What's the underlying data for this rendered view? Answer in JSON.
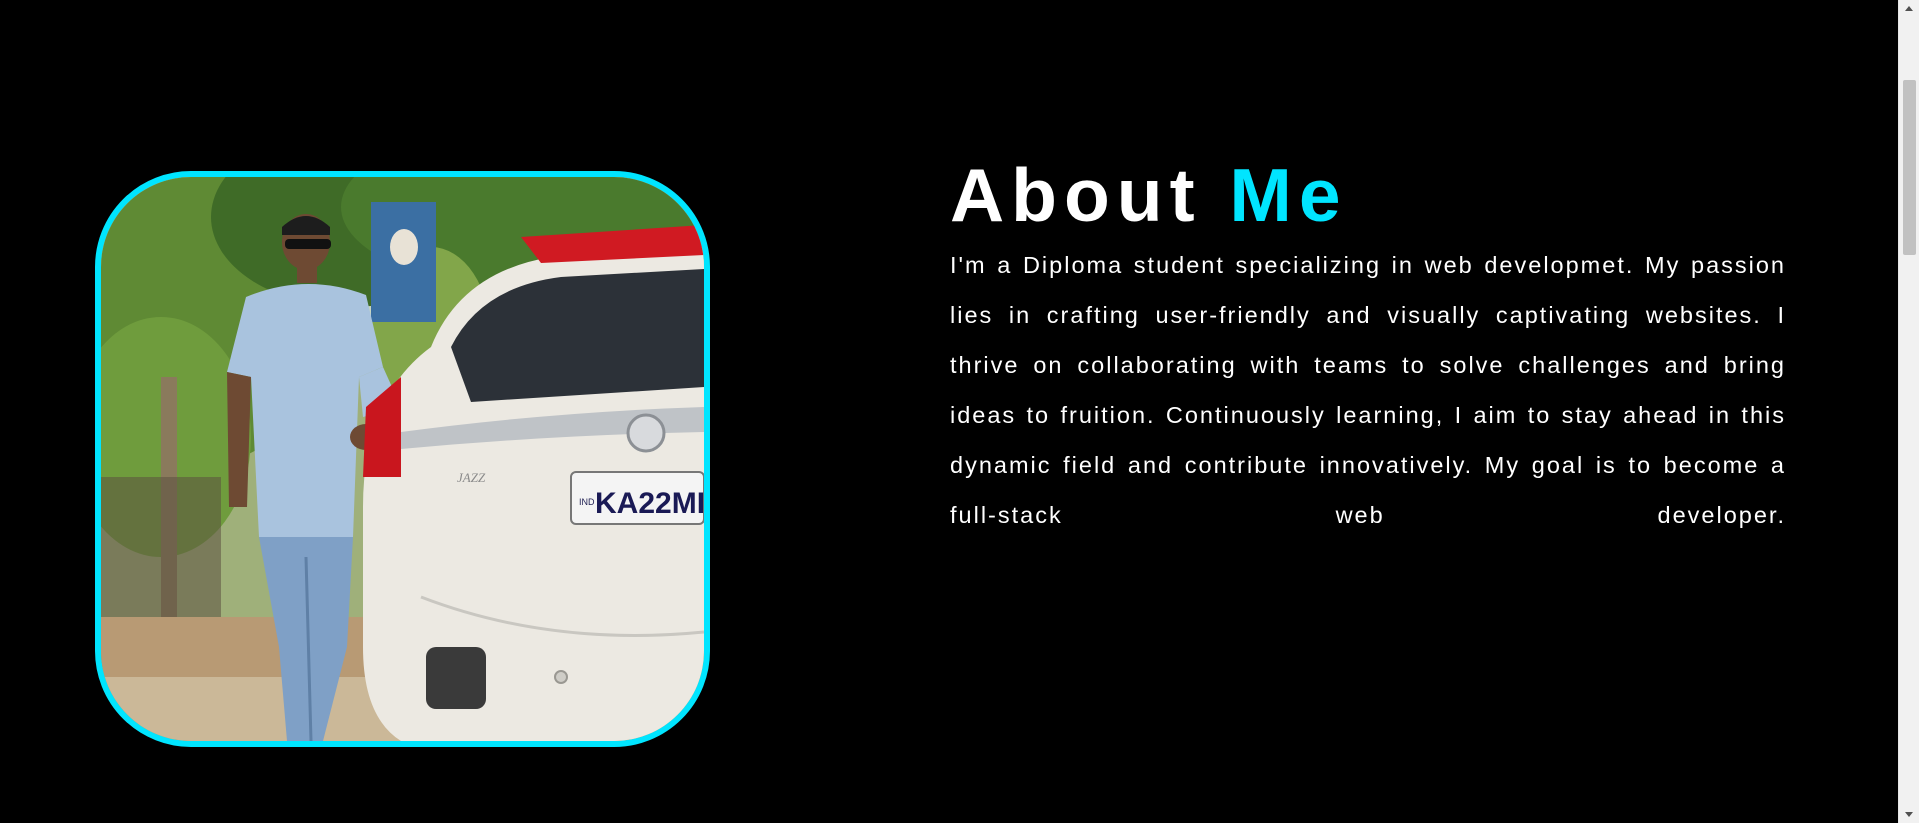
{
  "about": {
    "title_main": "About",
    "title_accent": "Me",
    "paragraph": "I'm a Diploma student specializing in web developmet. My passion lies in crafting user-friendly and visually captivating websites. I thrive on collaborating with teams to solve challenges and bring ideas to fruition. Continuously learning, I aim to stay ahead in this dynamic field and contribute innovatively. My goal is to become a full-stack web developer."
  },
  "photo": {
    "plate_text": "KA22MI",
    "car_badge": "JAZZ",
    "plate_country": "IND"
  },
  "colors": {
    "accent": "#00e5ff",
    "background": "#000000",
    "text": "#ffffff"
  }
}
